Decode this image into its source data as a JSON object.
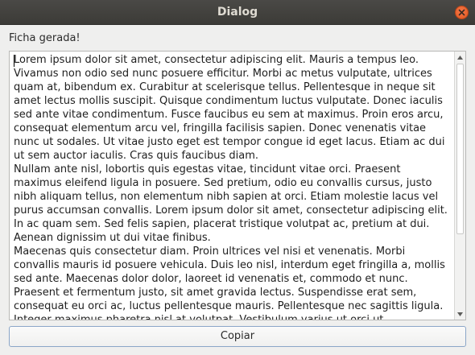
{
  "window": {
    "title": "Dialog"
  },
  "label": "Ficha gerada!",
  "textarea": {
    "text": "Lorem ipsum dolor sit amet, consectetur adipiscing elit. Mauris a tempus leo. Vivamus non odio sed nunc posuere efficitur. Morbi ac metus vulputate, ultrices quam at, bibendum ex. Curabitur at scelerisque tellus. Pellentesque in neque sit amet lectus mollis suscipit. Quisque condimentum luctus vulputate. Donec iaculis sed ante vitae condimentum. Fusce faucibus eu sem at maximus. Proin eros arcu, consequat elementum arcu vel, fringilla facilisis sapien. Donec venenatis vitae nunc ut sodales. Ut vitae justo eget est tempor congue id eget lacus. Etiam ac dui ut sem auctor iaculis. Cras quis faucibus diam.\nNullam ante nisl, lobortis quis egestas vitae, tincidunt vitae orci. Praesent maximus eleifend ligula in posuere. Sed pretium, odio eu convallis cursus, justo nibh aliquam tellus, non elementum nibh sapien at orci. Etiam molestie lacus vel purus accumsan convallis. Lorem ipsum dolor sit amet, consectetur adipiscing elit. In ac quam sem. Sed felis sapien, placerat tristique volutpat ac, pretium at dui. Aenean dignissim ut dui vitae finibus.\nMaecenas quis consectetur diam. Proin ultrices vel nisi et venenatis. Morbi convallis mauris id posuere vehicula. Duis leo nisl, interdum eget fringilla a, mollis sed ante. Maecenas dolor dolor, laoreet id venenatis et, commodo et nunc. Praesent et fermentum justo, sit amet gravida lectus. Suspendisse erat sem, consequat eu orci ac, luctus pellentesque mauris. Pellentesque nec sagittis ligula. Integer maximus pharetra nisl at volutpat. Vestibulum varius ut orci ut"
  },
  "button": {
    "label": "Copiar"
  },
  "icons": {
    "close": "close-icon",
    "scroll_up": "arrow-up-icon",
    "scroll_down": "arrow-down-icon"
  },
  "colors": {
    "titlebar": "#3c3b37",
    "close_button": "#e95420",
    "button_border": "#8ba6c8"
  }
}
